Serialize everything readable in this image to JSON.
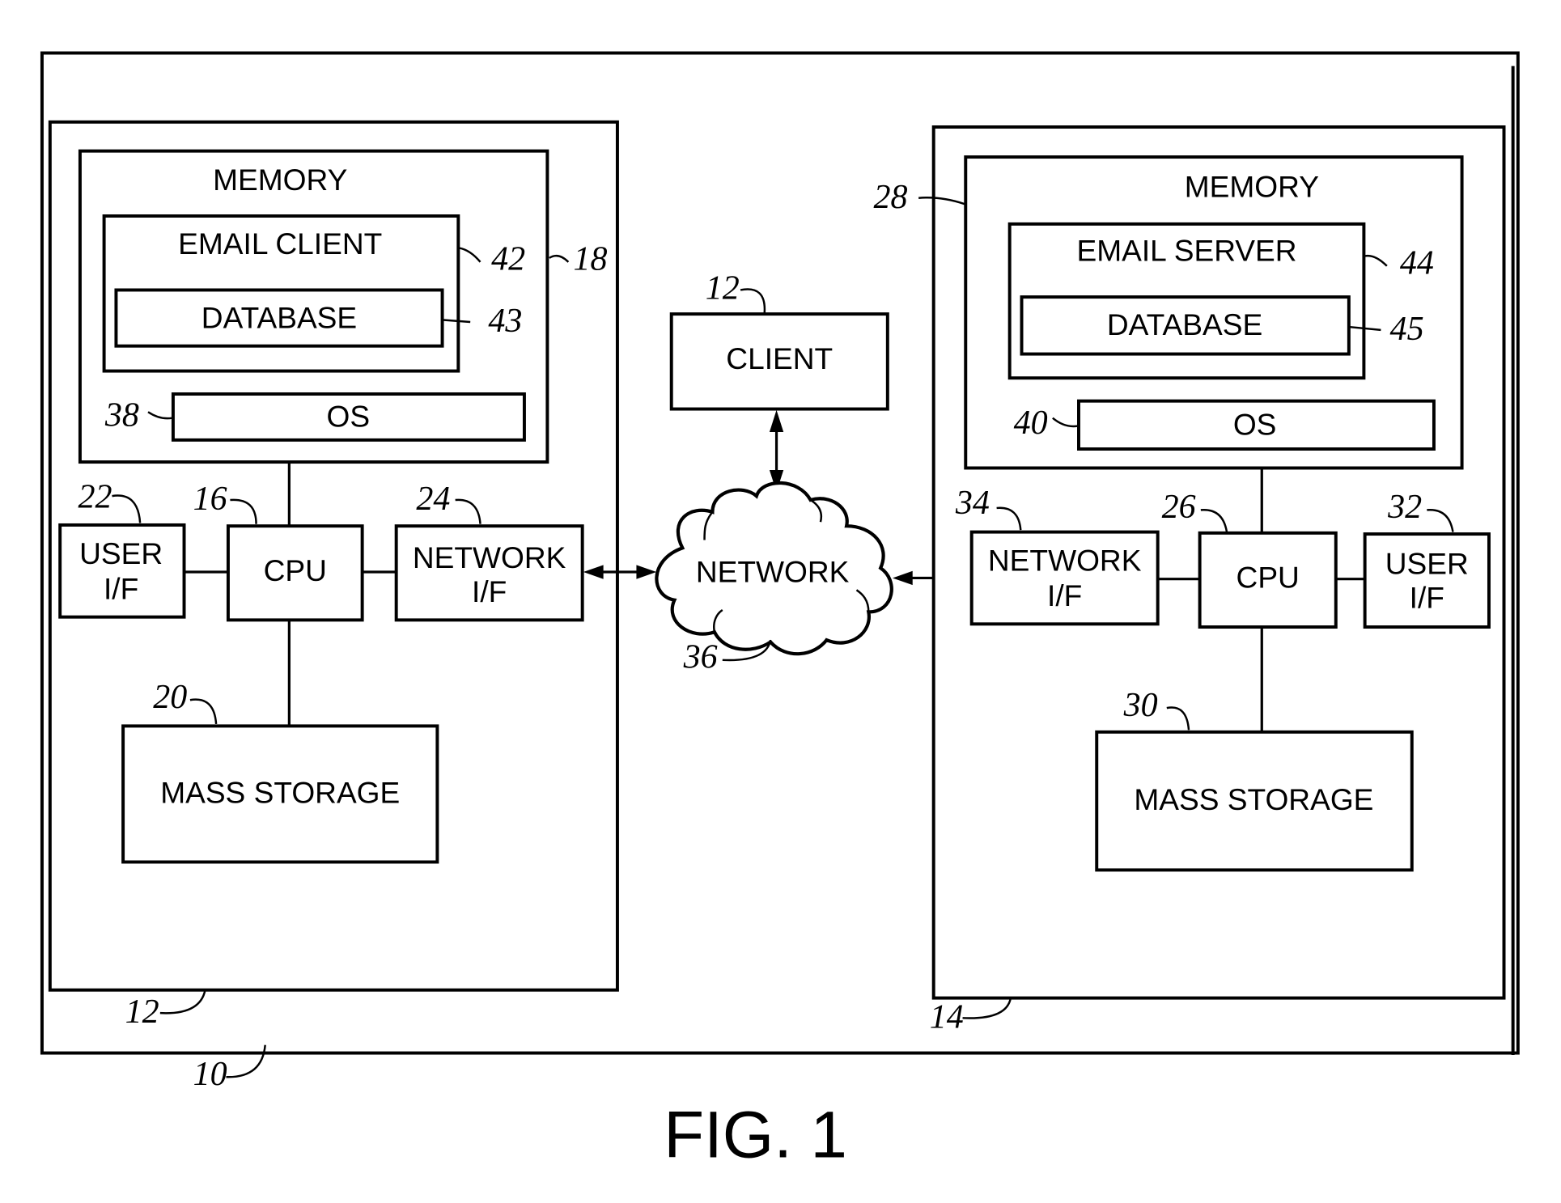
{
  "figure": {
    "caption": "FIG. 1",
    "system_ref": "10"
  },
  "client_computer": {
    "ref": "12",
    "memory": {
      "label": "MEMORY",
      "ref": "18"
    },
    "email_client": {
      "label": "EMAIL CLIENT",
      "ref": "42"
    },
    "database": {
      "label": "DATABASE",
      "ref": "43"
    },
    "os": {
      "label": "OS",
      "ref": "38"
    },
    "user_if": {
      "label_line1": "USER",
      "label_line2": "I/F",
      "ref": "22"
    },
    "cpu": {
      "label": "CPU",
      "ref": "16"
    },
    "network_if": {
      "label_line1": "NETWORK",
      "label_line2": "I/F",
      "ref": "24"
    },
    "mass_storage": {
      "label": "MASS STORAGE",
      "ref": "20"
    }
  },
  "server_computer": {
    "ref": "14",
    "memory": {
      "label": "MEMORY",
      "ref": "28"
    },
    "email_server": {
      "label": "EMAIL SERVER",
      "ref": "44"
    },
    "database": {
      "label": "DATABASE",
      "ref": "45"
    },
    "os": {
      "label": "OS",
      "ref": "40"
    },
    "network_if": {
      "label_line1": "NETWORK",
      "label_line2": "I/F",
      "ref": "34"
    },
    "cpu": {
      "label": "CPU",
      "ref": "26"
    },
    "user_if": {
      "label_line1": "USER",
      "label_line2": "I/F",
      "ref": "32"
    },
    "mass_storage": {
      "label": "MASS STORAGE",
      "ref": "30"
    }
  },
  "client_node": {
    "label": "CLIENT",
    "ref": "12"
  },
  "network": {
    "label": "NETWORK",
    "ref": "36"
  }
}
